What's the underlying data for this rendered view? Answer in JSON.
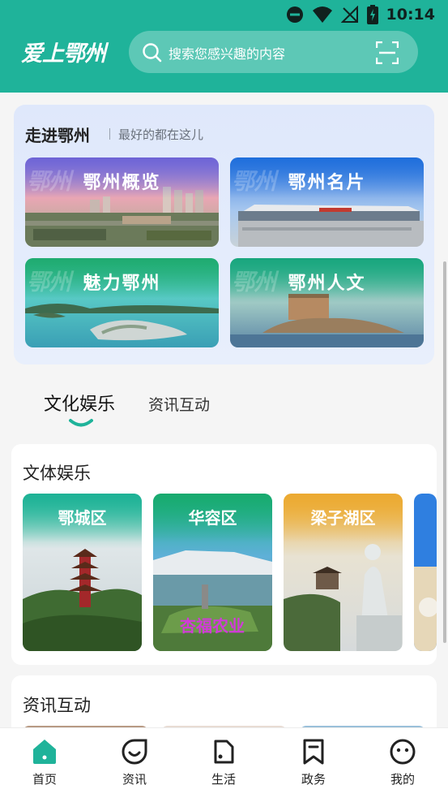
{
  "status_bar": {
    "time": "10:14",
    "icons": [
      "dnd-icon",
      "wifi-icon",
      "no-signal-icon",
      "battery-charging-icon"
    ]
  },
  "header": {
    "logo": "爱上鄂州",
    "search_placeholder": "搜索您感兴趣的内容",
    "accent_color": "#1fb39a"
  },
  "intro": {
    "title": "走进鄂州",
    "subtitle": "最好的都在这儿",
    "tiles": [
      {
        "label": "鄂州概览",
        "watermark": "鄂州"
      },
      {
        "label": "鄂州名片",
        "watermark": "鄂州"
      },
      {
        "label": "魅力鄂州",
        "watermark": "鄂州"
      },
      {
        "label": "鄂州人文",
        "watermark": "鄂州"
      }
    ]
  },
  "tabs": [
    {
      "label": "文化娱乐",
      "active": true
    },
    {
      "label": "资讯互动",
      "active": false
    }
  ],
  "culture_section": {
    "title": "文体娱乐",
    "districts": [
      {
        "label": "鄂城区"
      },
      {
        "label": "华容区"
      },
      {
        "label": "梁子湖区"
      }
    ],
    "garden_sign": "杏福农业"
  },
  "news_section": {
    "title": "资讯互动"
  },
  "bottom_nav": [
    {
      "label": "首页",
      "icon": "home-icon",
      "active": true
    },
    {
      "label": "资讯",
      "icon": "news-icon",
      "active": false
    },
    {
      "label": "生活",
      "icon": "life-icon",
      "active": false
    },
    {
      "label": "政务",
      "icon": "bookmark-icon",
      "active": false
    },
    {
      "label": "我的",
      "icon": "profile-icon",
      "active": false
    }
  ]
}
